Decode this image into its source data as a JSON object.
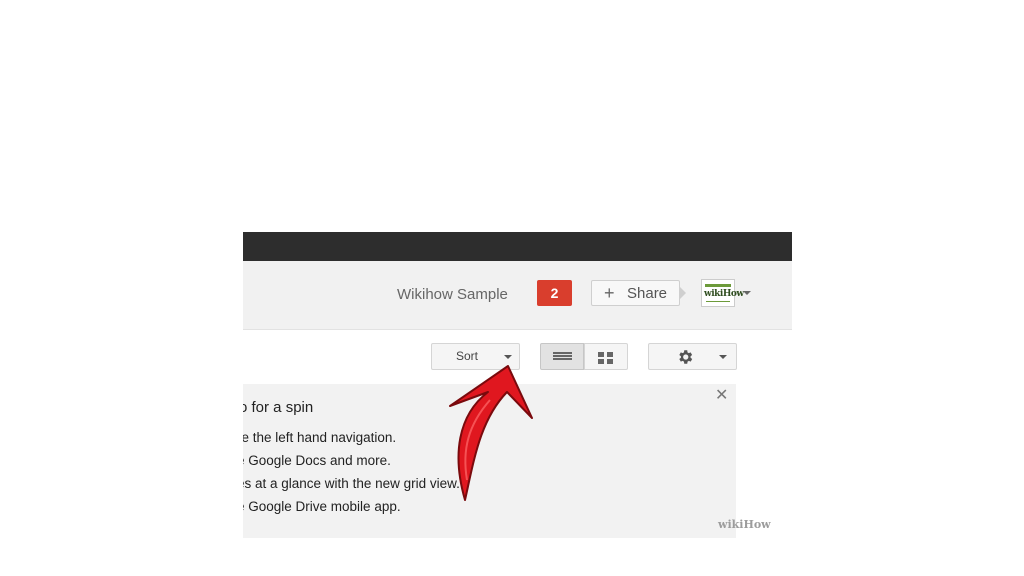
{
  "header": {
    "user_name": "Wikihow Sample",
    "notification_count": "2",
    "share_label": "Share",
    "share_icon": "plus-icon",
    "avatar_text": "wikiHow",
    "account_icon": "chevron-down-icon"
  },
  "toolbar": {
    "sort_label": "Sort",
    "sort_icon": "chevron-down-icon",
    "list_view_icon": "list-view-icon",
    "grid_view_icon": "grid-view-icon",
    "list_view_selected": true,
    "settings_icon": "gear-icon"
  },
  "promo": {
    "title": "o for a spin",
    "lines": [
      "re the left hand navigation.",
      "e Google Docs and more.",
      "es at a glance with the new grid view.",
      "e Google Drive mobile app."
    ],
    "close_icon": "close-icon"
  },
  "watermark": "wikiHow",
  "annotation": {
    "arrow_icon": "red-arrow-icon",
    "color": "#e0171f"
  },
  "colors": {
    "topbar": "#2d2d2d",
    "header_bg": "#f1f1f1",
    "badge": "#d93e2d",
    "promo_bg": "#f2f2f2"
  }
}
